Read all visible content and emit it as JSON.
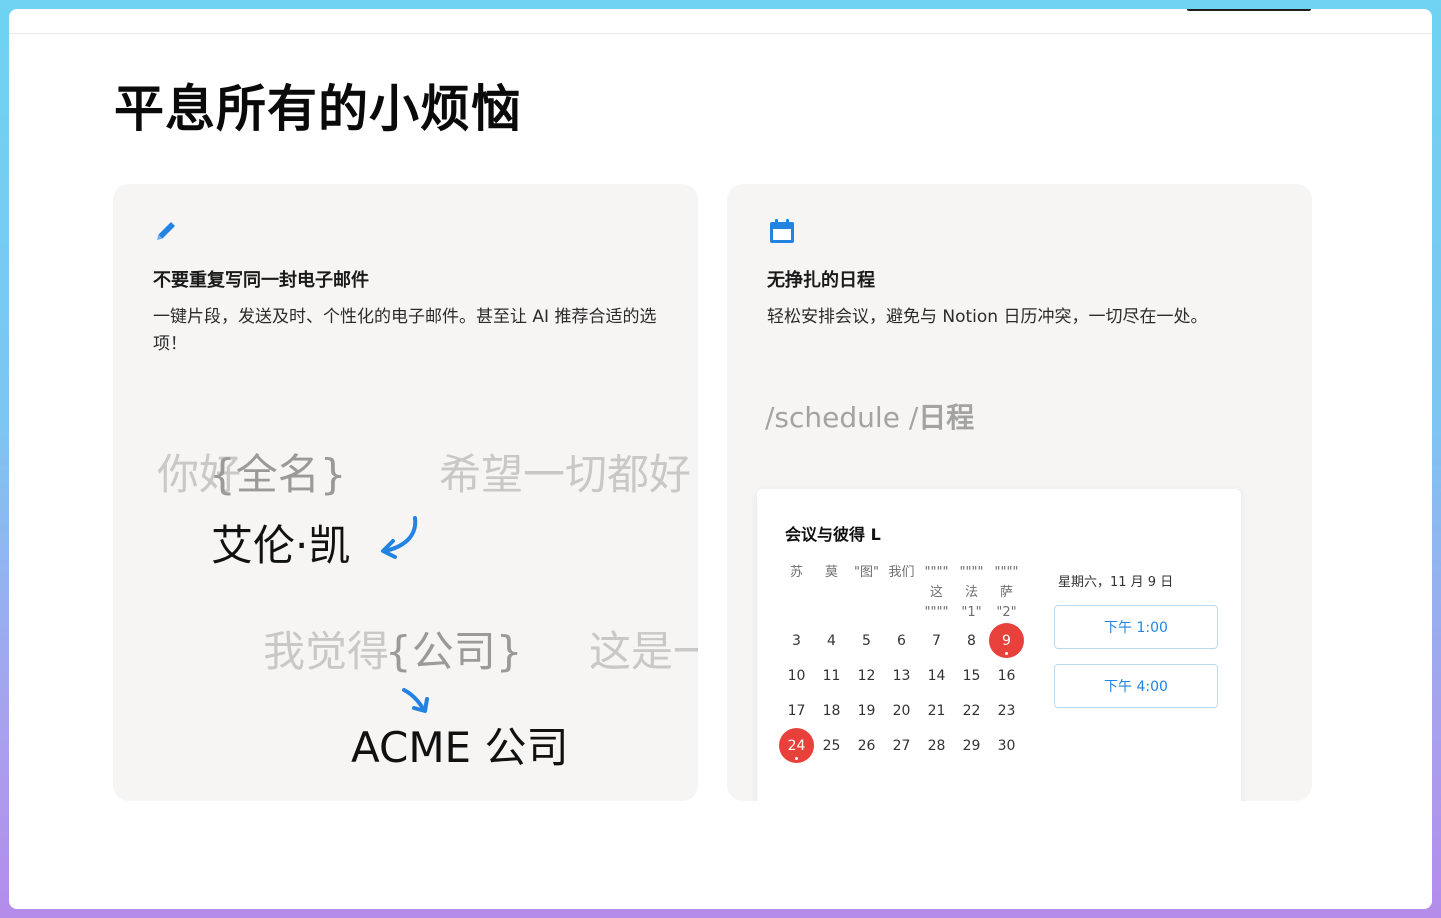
{
  "headline": "平息所有的小烦恼",
  "colors": {
    "accent": "#2383e2",
    "highlight": "#e8403a",
    "card_bg": "#f6f5f4"
  },
  "left_card": {
    "icon": "pencil-icon",
    "title": "不要重复写同一封电子邮件",
    "description": "一键片段，发送及时、个性化的电子邮件。甚至让 AI 推荐合适的选项！",
    "illustration": {
      "line1_prefix": "你好",
      "line1_placeholder": "{全名}",
      "line1_right": "希望一切都好",
      "name_value": "艾伦·凯",
      "line2_prefix": "我觉得",
      "line2_placeholder": "{公司}",
      "line2_right": "这是一",
      "company_value": "ACME 公司"
    }
  },
  "right_card": {
    "icon": "calendar-icon",
    "title": "无挣扎的日程",
    "description": "轻松安排会议，避免与 Notion 日历冲突，一切尽在一处。",
    "command": {
      "en": "/schedule /",
      "zh": "日程"
    },
    "calendar": {
      "title": "会议与彼得 L",
      "weekdays": [
        {
          "top": "苏",
          "mid": "",
          "bot": ""
        },
        {
          "top": "莫",
          "mid": "",
          "bot": ""
        },
        {
          "top": "\"图\"",
          "mid": "",
          "bot": ""
        },
        {
          "top": "我们",
          "mid": "",
          "bot": ""
        },
        {
          "top": "\"\"\"\"",
          "mid": "这",
          "bot": "\"\"\"\""
        },
        {
          "top": "\"\"\"\"",
          "mid": "法",
          "bot": "\"1\""
        },
        {
          "top": "\"\"\"\"",
          "mid": "萨",
          "bot": "\"2\""
        }
      ],
      "weeks": [
        [
          "3",
          "4",
          "5",
          "6",
          "7",
          "8",
          "9"
        ],
        [
          "10",
          "11",
          "12",
          "13",
          "14",
          "15",
          "16"
        ],
        [
          "17",
          "18",
          "19",
          "20",
          "21",
          "22",
          "23"
        ],
        [
          "24",
          "25",
          "26",
          "27",
          "28",
          "29",
          "30"
        ]
      ],
      "selected_date": "星期六，11 月 9 日",
      "times": [
        "下午 1:00",
        "下午 4:00"
      ]
    }
  }
}
